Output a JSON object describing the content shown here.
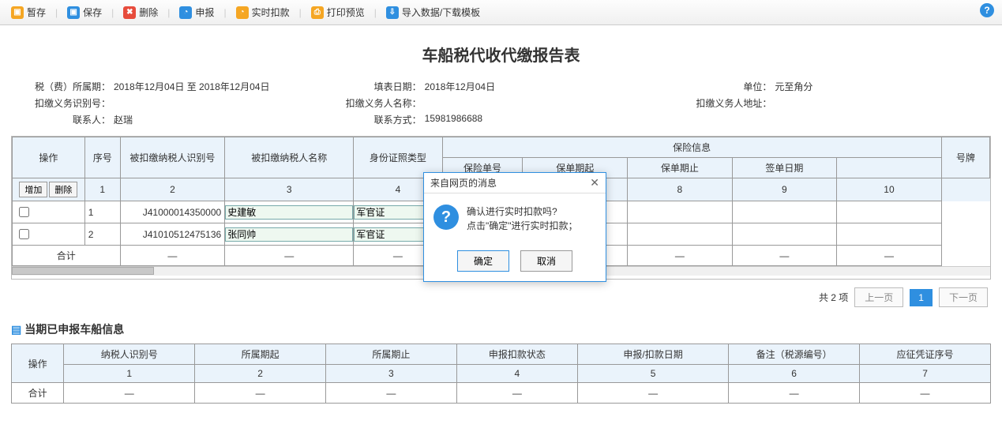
{
  "toolbar": {
    "tempSave": "暂存",
    "save": "保存",
    "delete": "删除",
    "declare": "申报",
    "realtimeDeduct": "实时扣款",
    "printPreview": "打印预览",
    "importData": "导入数据/下载模板"
  },
  "report": {
    "title": "车船税代收代缴报告表",
    "labels": {
      "period": "税（费）所属期：",
      "fillDate": "填表日期：",
      "unit": "单位：",
      "withholderId": "扣缴义务识别号：",
      "withholderName": "扣缴义务人名称：",
      "withholderAddr": "扣缴义务人地址：",
      "contact": "联系人：",
      "contactWay": "联系方式："
    },
    "values": {
      "period": "2018年12月04日 至 2018年12月04日",
      "fillDate": "2018年12月04日",
      "unit": "元至角分",
      "withholderId": "",
      "withholderName": "",
      "withholderAddr": "",
      "contact": "赵瑞",
      "contactWay": "15981986688"
    }
  },
  "mainTable": {
    "headers": {
      "op": "操作",
      "seq": "序号",
      "taxpayerId": "被扣缴纳税人识别号",
      "taxpayerName": "被扣缴纳税人名称",
      "idType": "身份证照类型",
      "insuranceGroup": "保险信息",
      "policyNo": "保险单号",
      "policyStart": "保单期起",
      "policyEnd": "保单期止",
      "signDate": "签单日期",
      "plate": "号牌"
    },
    "opAdd": "增加",
    "opDel": "删除",
    "colNums": [
      "1",
      "2",
      "3",
      "4",
      "6",
      "7",
      "8",
      "9",
      "10"
    ],
    "rows": [
      {
        "seq": "1",
        "taxpayerId": "J41000014350000",
        "taxpayerName": "史建敏",
        "idType": "军官证",
        "policyNo": "",
        "policyStart": "",
        "policyEnd": "",
        "signDate": "",
        "plate": ""
      },
      {
        "seq": "2",
        "taxpayerId": "J41010512475136",
        "taxpayerName": "张同帅",
        "idType": "军官证",
        "policyNo": "",
        "policyStart": "",
        "policyEnd": "",
        "signDate": "",
        "plate": ""
      }
    ],
    "totalLabel": "合计",
    "dash": "—"
  },
  "pager": {
    "total": "共 2 项",
    "prev": "上一页",
    "page": "1",
    "next": "下一页"
  },
  "section2": {
    "title": "当期已申报车船信息"
  },
  "subTable": {
    "headers": {
      "op": "操作",
      "taxpayerId": "纳税人识别号",
      "periodStart": "所属期起",
      "periodEnd": "所属期止",
      "declareStatus": "申报扣款状态",
      "declareDate": "申报/扣款日期",
      "remark": "备注（税源编号）",
      "voucherNo": "应征凭证序号"
    },
    "colNums": [
      "1",
      "2",
      "3",
      "4",
      "5",
      "6",
      "7"
    ],
    "totalLabel": "合计",
    "dash": "—"
  },
  "modal": {
    "title": "来自网页的消息",
    "line1": "确认进行实时扣款吗?",
    "line2": "点击\"确定\"进行实时扣款；",
    "ok": "确定",
    "cancel": "取消"
  }
}
